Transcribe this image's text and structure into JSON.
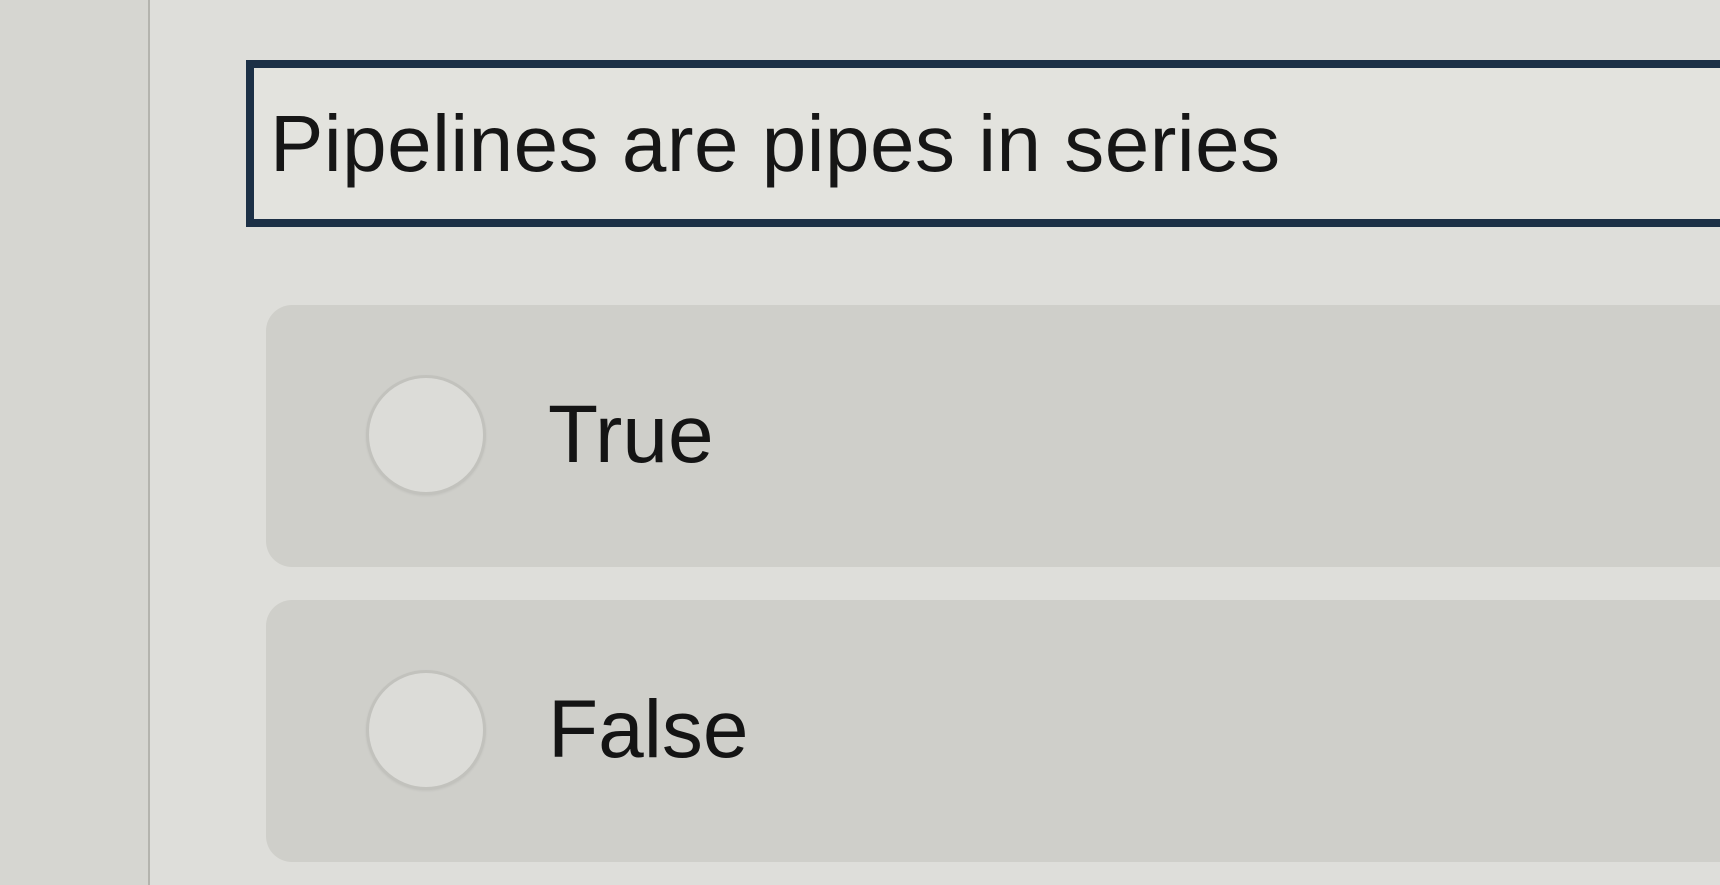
{
  "question": {
    "text": "Pipelines are pipes in series"
  },
  "options": [
    {
      "label": "True",
      "selected": false
    },
    {
      "label": "False",
      "selected": false
    }
  ],
  "colors": {
    "question_border": "#1c3046",
    "option_background": "#cfcfca",
    "page_background": "#dededa"
  }
}
